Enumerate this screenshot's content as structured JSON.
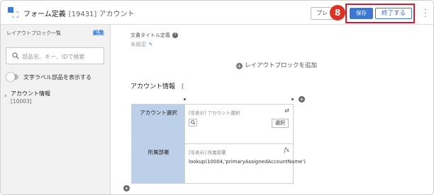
{
  "header": {
    "title": "フォーム定義",
    "id_label": "[19431] アカウント",
    "preview_label": "プレ",
    "step_number": "8",
    "save_label": "保存",
    "finish_label": "終了する"
  },
  "sidebar": {
    "title": "レイアウトブロック一覧",
    "edit_label": "編集",
    "search_placeholder": "部品名、キー、IDで検索",
    "toggle_label": "文字ラベル部品を表示する",
    "toggle_on": false,
    "tree": [
      {
        "label": "アカウント情報",
        "sub": "[10003]"
      }
    ]
  },
  "main": {
    "doc_title_label": "文書タイトル定義",
    "doc_title_value": "未設定",
    "add_block_label": "レイアウトブロックを追加",
    "section_title": "アカウント情報",
    "rows": [
      {
        "label": "アカウント選択",
        "note": "[非表示] アカウント選択",
        "action": "選択"
      },
      {
        "label": "所属部署",
        "note": "[非表示] 所属部署",
        "formula": "lookup(10004,'primaryAssignedAccountName')"
      }
    ]
  },
  "colors": {
    "accent": "#3c77d4",
    "highlight": "#d01c34",
    "badge": "#d93426",
    "label_cell": "#bdd0ea"
  }
}
